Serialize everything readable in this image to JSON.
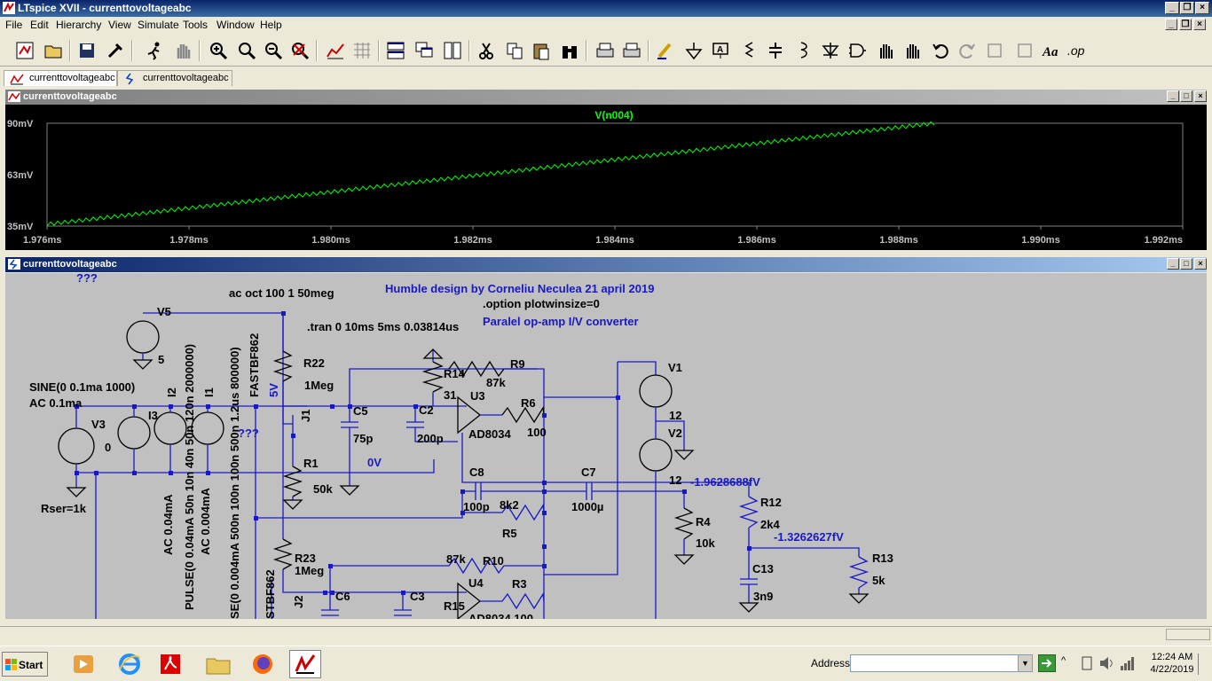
{
  "app": {
    "title": "LTspice XVII - currenttovoltageabc"
  },
  "menu": [
    "File",
    "Edit",
    "Hierarchy",
    "View",
    "Simulate",
    "Tools",
    "Window",
    "Help"
  ],
  "tabs": [
    {
      "label": "currenttovoltageabc",
      "icon": "waveform-icon"
    },
    {
      "label": "currenttovoltageabc",
      "icon": "schematic-icon"
    }
  ],
  "plot_window": {
    "title": "currenttovoltageabc",
    "trace_color": "#00ff00"
  },
  "chart_data": {
    "type": "line",
    "series": [
      {
        "name": "V(n004)",
        "color": "#00ff00"
      }
    ],
    "y_ticks": [
      "90mV",
      "63mV",
      "35mV"
    ],
    "x_ticks": [
      "1.976ms",
      "1.978ms",
      "1.980ms",
      "1.982ms",
      "1.984ms",
      "1.986ms",
      "1.988ms",
      "1.990ms",
      "1.992ms"
    ],
    "xlim": [
      1.976,
      1.992
    ],
    "ylim": [
      35,
      90
    ],
    "x_unit": "ms",
    "y_unit": "mV",
    "trend": {
      "x_start": 1.976,
      "y_start": 36,
      "x_end": 1.9885,
      "y_end": 90
    },
    "ripple_amplitude_mV": 2,
    "ripple_period_ms": 0.0001
  },
  "schematic_window": {
    "title": "currenttovoltageabc",
    "texts": {
      "unknown1": "???",
      "unknown2": "???",
      "ac_cmd": "ac oct 100 1 50meg",
      "author": "Humble design by Corneliu Neculea 21 april 2019",
      "option": ".option plotwinsize=0",
      "tran": ".tran 0 10ms 5ms 0.03814us",
      "desc": "Paralel op-amp I/V converter",
      "V5": "V5",
      "V5_val": "5",
      "R22": "R22",
      "R22_val": "1Meg",
      "FASTBF862": "FASTBF862",
      "fivev": "5V",
      "J1": "J1",
      "sine": "SINE(0 0.1ma 1000)",
      "ac01": "AC 0.1ma",
      "V3": "V3",
      "V3_val": "0",
      "I3": "I3",
      "I2": "I2",
      "I1": "I1",
      "I2_pulse": "PULSE(0 0.04mA 50n 10n 40n 50n 120n 2000000)",
      "I2_ac": "AC 0.04mA",
      "I1_pulse": "SE(0 0.004mA 500n 100n 100n 500n 1.2us 800000)",
      "I1_ac": "AC 0.004mA",
      "C5": "C5",
      "C5_val": "75p",
      "C2": "C2",
      "C2_val": "200p",
      "R14": "R14",
      "R14_val": "31",
      "R9": "R9",
      "R9_val": "87k",
      "U3": "U3",
      "U3_val": "AD8034",
      "R6": "R6",
      "R6_val": "100",
      "V1": "V1",
      "V1_val": "12",
      "V2": "V2",
      "V2_val": "12",
      "R1": "R1",
      "R1_val": "50k",
      "zerov": "0V",
      "Rser": "Rser=1k",
      "C8": "C8",
      "C8_val": "100p",
      "C7": "C7",
      "C7_val": "1000µ",
      "R5_val": "8k2",
      "R5": "R5",
      "node1": "-1.9628688fV",
      "R12": "R12",
      "R12_val": "2k4",
      "R4": "R4",
      "R4_val": "10k",
      "node2": "-1.3262627fV",
      "R13": "R13",
      "R13_val": "5k",
      "C13": "C13",
      "C13_val": "3n9",
      "R23": "R23",
      "R23_val": "1Meg",
      "R10_val": "87k",
      "R10": "R10",
      "U4": "U4",
      "R3": "R3",
      "STBF862": "STBF862",
      "J2": "J2",
      "C6": "C6",
      "C3": "C3",
      "R15": "R15",
      "U4_val": "AD8034 100"
    }
  },
  "taskbar": {
    "start": "Start",
    "address_label": "Address",
    "address_value": "",
    "time": "12:24 AM",
    "date": "4/22/2019"
  }
}
